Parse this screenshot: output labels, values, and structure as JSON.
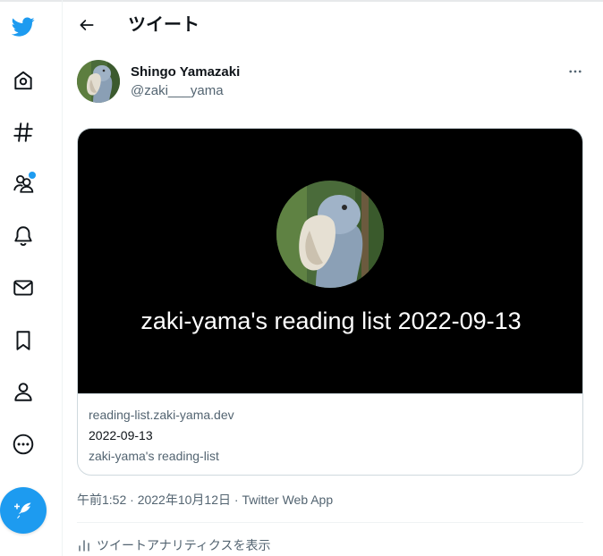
{
  "colors": {
    "accent": "#1d9bf0",
    "text_primary": "#0f1419",
    "text_secondary": "#536471",
    "border": "#cfd9de"
  },
  "sidebar": {
    "items": [
      {
        "icon": "twitter-logo-icon"
      },
      {
        "icon": "home-icon"
      },
      {
        "icon": "hashtag-explore-icon"
      },
      {
        "icon": "communities-icon",
        "has_badge": true
      },
      {
        "icon": "bell-notifications-icon"
      },
      {
        "icon": "mail-messages-icon"
      },
      {
        "icon": "bookmark-icon"
      },
      {
        "icon": "person-profile-icon"
      },
      {
        "icon": "more-circle-icon"
      }
    ],
    "compose_icon": "feather-compose-icon"
  },
  "header": {
    "title": "ツイート",
    "back_icon": "back-arrow-icon"
  },
  "tweet": {
    "author_name": "Shingo Yamazaki",
    "author_handle": "@zaki___yama",
    "more_icon": "more-horizontal-icon",
    "card": {
      "image_text": "zaki-yama's reading list 2022-09-13",
      "domain": "reading-list.zaki-yama.dev",
      "title": "2022-09-13",
      "description": "zaki-yama's reading-list"
    },
    "time": "午前1:52",
    "separator": " · ",
    "date": "2022年10月12日",
    "source": "Twitter Web App",
    "analytics_label": "ツイートアナリティクスを表示",
    "analytics_icon": "bar-chart-icon"
  }
}
